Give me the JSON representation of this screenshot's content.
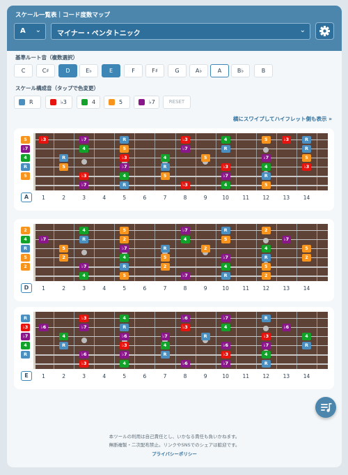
{
  "app": {
    "title": "スケール一覧表｜コード度数マップ"
  },
  "controls": {
    "key": "A",
    "scale": "マイナー・ペンタトニック"
  },
  "roots": {
    "section_title": "基準ルート音（複数選択）",
    "notes": [
      "C",
      "C♯",
      "D",
      "E♭",
      "E",
      "F",
      "F♯",
      "G",
      "A♭",
      "A",
      "B♭",
      "B"
    ],
    "selected": [
      "D",
      "E"
    ],
    "outlined": [
      "A"
    ]
  },
  "intervals": {
    "section_title": "スケール構成音（タップで色変更）",
    "items": [
      {
        "label": "R",
        "color": "#4a8fc0"
      },
      {
        "label": "♭3",
        "color": "#e5140e"
      },
      {
        "label": "4",
        "color": "#12a22a"
      },
      {
        "label": "5",
        "color": "#f7941d"
      },
      {
        "label": "♭7",
        "color": "#8a178a"
      }
    ],
    "reset_label": "RESET"
  },
  "hint": "横にスワイプしてハイフレット側も表示 »",
  "fret_numbers": [
    "1",
    "2",
    "3",
    "4",
    "5",
    "6",
    "7",
    "8",
    "9",
    "10",
    "11",
    "12",
    "13",
    "14"
  ],
  "colors": {
    "R": "#4a8fc0",
    "♭3": "#e5140e",
    "4": "#12a22a",
    "5": "#f7941d",
    "♭7": "#8a178a",
    "♭6": "#e5140e",
    "♭5": "#8a178a"
  },
  "panels": [
    {
      "root": "A",
      "open": [
        "5",
        "♭7",
        "4",
        "R",
        "5"
      ],
      "rows": [
        [
          "5",
          "",
          "♭3",
          "",
          "",
          "R",
          "",
          "",
          "♭3",
          "",
          "",
          "5",
          "",
          "",
          "R"
        ],
        [
          "♭7",
          "",
          "",
          "R",
          "",
          "",
          "♭3",
          "",
          "",
          "5",
          "",
          "",
          "♭7",
          "",
          ""
        ],
        [
          "4",
          "",
          "",
          "",
          "♭7",
          "",
          "",
          "R",
          "",
          "",
          "♭3",
          "",
          "",
          "5",
          ""
        ],
        [
          "R",
          "",
          "",
          "",
          "",
          "4",
          "",
          "",
          "",
          "",
          "",
          "",
          "",
          "",
          ""
        ],
        [
          "5",
          "",
          "",
          "",
          "",
          "",
          "",
          "",
          "",
          "",
          "",
          "",
          "",
          "",
          ""
        ],
        [
          "",
          "",
          "",
          "",
          "",
          "",
          "",
          "",
          "",
          "",
          "",
          "",
          "",
          "",
          ""
        ]
      ]
    }
  ]
}
